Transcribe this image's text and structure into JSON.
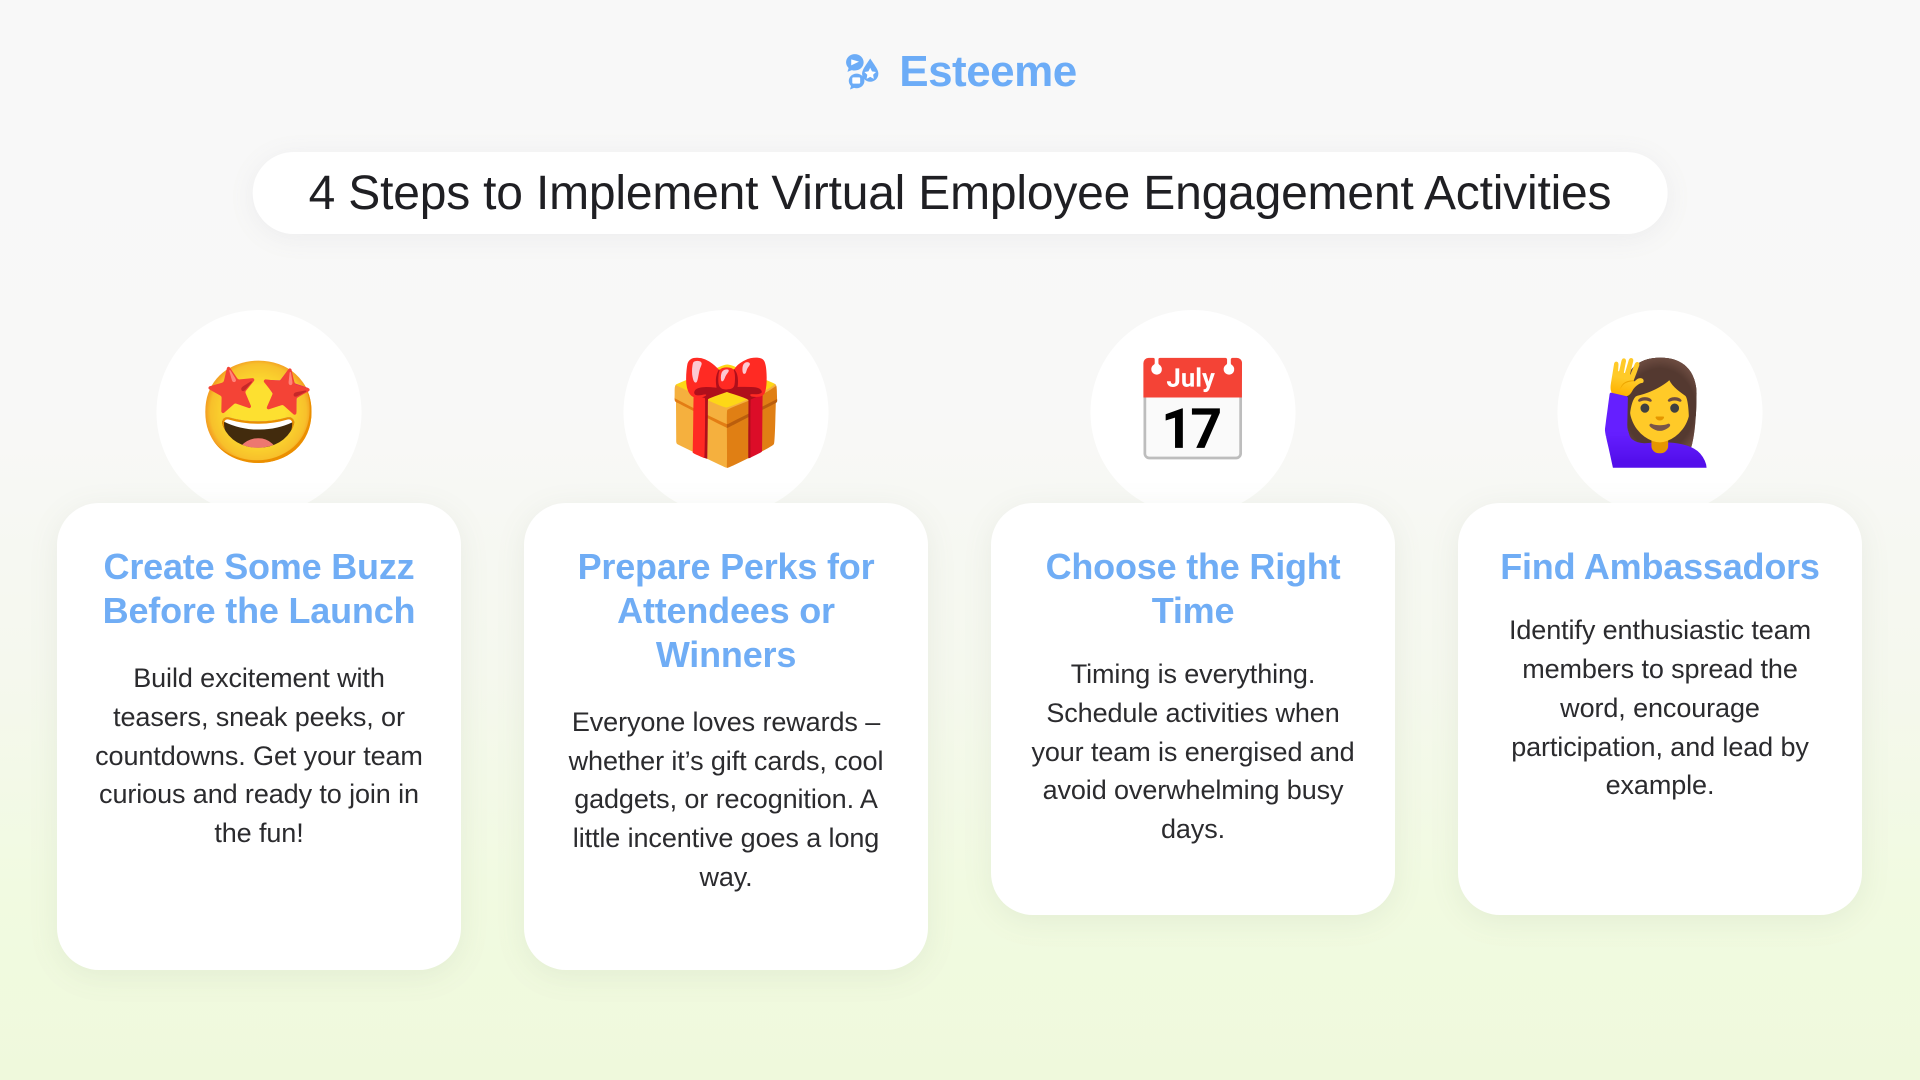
{
  "brand": {
    "name": "Esteeme",
    "logo_icon": "esteeme-bubbles-star-logo",
    "color": "#6CACF7"
  },
  "header": {
    "title": "4 Steps to Implement Virtual Employee Engagement Activities"
  },
  "theme": {
    "heading_blue": "#70ADF5",
    "body_text": "#2B2B2E",
    "card_background": "#FFFFFF",
    "page_gradient_top": "#F8F8F8",
    "page_gradient_bottom": "#EFF9DC"
  },
  "steps": [
    {
      "icon": "star-struck-face-emoji",
      "icon_glyph": "🤩",
      "title": "Create Some Buzz Before the Launch",
      "body": "Build excitement with teasers, sneak peeks, or countdowns. Get your team curious and ready to join in the fun!"
    },
    {
      "icon": "wrapped-gift-emoji",
      "icon_glyph": "🎁",
      "title": "Prepare Perks for Attendees or Winners",
      "body": "Everyone loves rewards – whether it’s gift cards, cool gadgets, or recognition. A little incentive goes a long way."
    },
    {
      "icon": "tear-off-calendar-emoji",
      "icon_glyph": "📅",
      "calendar_month": "JUL",
      "calendar_day": "17",
      "title": "Choose the Right Time",
      "body": "Timing is everything. Schedule activities when your team is energised and avoid overwhelming busy days."
    },
    {
      "icon": "woman-raising-hand-emoji",
      "icon_glyph": "🙋‍♀️",
      "title": "Find Ambassadors",
      "body": "Identify enthusiastic team members to spread the word, encourage participation, and lead by example."
    }
  ]
}
